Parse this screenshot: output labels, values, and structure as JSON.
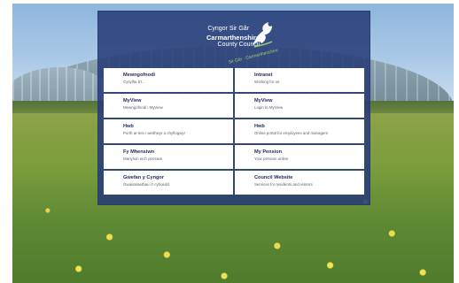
{
  "logo": {
    "line1": "Cyngor Sir Gâr",
    "line2": "Carmarthenshire",
    "line3": "County Council",
    "tagline": "Sir Gâr · Carmarthenshire"
  },
  "colors": {
    "panel": "#253a76",
    "card": "#ffffff",
    "title": "#1e2a55",
    "subtitle": "#5a5f6d"
  },
  "cards": [
    {
      "title": "Mewngofnodi",
      "subtitle": "Cysylltu â'r..."
    },
    {
      "title": "Intranet",
      "subtitle": "Working for us"
    },
    {
      "title": "MyView",
      "subtitle": "Mewngofnodi i MyView"
    },
    {
      "title": "MyView",
      "subtitle": "Login to MyView"
    },
    {
      "title": "Hwb",
      "subtitle": "Porth ar-lein i weithwyr a chyflogwyr"
    },
    {
      "title": "Hwb",
      "subtitle": "Online portal for employees and managers"
    },
    {
      "title": "Fy Mhensiwn",
      "subtitle": "Manylion eich pensiwn"
    },
    {
      "title": "My Pension",
      "subtitle": "Your pension online"
    },
    {
      "title": "Gwefan y Cyngor",
      "subtitle": "Gwasanaethau i'r cyhoedd"
    },
    {
      "title": "Council Website",
      "subtitle": "Services for residents and visitors"
    }
  ]
}
